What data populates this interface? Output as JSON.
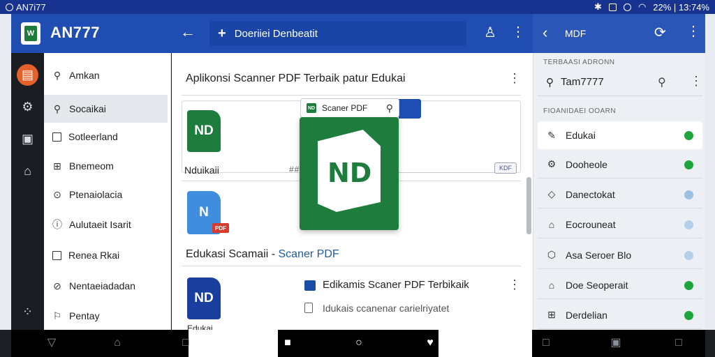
{
  "status_bar": {
    "left_text": "AN7i77",
    "right_text": "22% | 13:74%"
  },
  "header": {
    "app_title": "AN777",
    "search_text": "Doeriiei Denbeatit",
    "right_title": "MDF"
  },
  "rail": {
    "items": [
      "documents-icon",
      "settings-icon",
      "save-icon",
      "home-icon",
      "apps-icon"
    ]
  },
  "drawer": {
    "items": [
      {
        "label": "Amkan",
        "icon": "search-icon"
      },
      {
        "label": "Socaikai",
        "icon": "search-icon",
        "selected": true
      },
      {
        "label": "Sotleerland",
        "icon": "checkbox-icon"
      },
      {
        "label": "Bnemeom",
        "icon": "grid-icon"
      },
      {
        "label": "Ptenaiolacia",
        "icon": "circle-icon"
      },
      {
        "label": "Aulutaeit Isarit",
        "icon": "info-icon"
      },
      {
        "label": "Reneа Rkai",
        "icon": "checkbox-icon"
      },
      {
        "label": "Nentaeiadadan",
        "icon": "help-icon"
      },
      {
        "label": "Pentay",
        "icon": "pin-icon"
      }
    ]
  },
  "main": {
    "title": "Aplikonsi Scanner PDF Terbaik patur Edukai",
    "card1_icon_text": "ND",
    "card1_label": "Nduikaii",
    "card1_hash": "##",
    "card1_chip": "KDF",
    "card2_icon_text": "N",
    "card2_badge": "PDF",
    "section_prefix": "Edukasi Scamaii - ",
    "section_brand": "Scaner PDF",
    "card3_icon_text": "ND",
    "card3_title": "Edikamis Scaner PDF Terbikaik",
    "card3_sub": "Idukais ccanenar carielriyatet",
    "card3_caption": "Edukai"
  },
  "popup": {
    "chip_text": "Scaner PDF",
    "chip_icon_text": "ND",
    "logo_text": "ND"
  },
  "right_panel": {
    "section1": "TERBAASI ADRONN",
    "search_value": "Tam7777",
    "section2": "FIOANIDAEI OOARN",
    "items": [
      {
        "label": "Edukai",
        "icon": "edit-icon",
        "dot": "#1fa33b",
        "selected": true
      },
      {
        "label": "Dooheole",
        "icon": "settings-icon",
        "dot": "#1fa33b"
      },
      {
        "label": "Danectokat",
        "icon": "tag-icon",
        "dot": "#9dc0e0"
      },
      {
        "label": "Eocrouneat",
        "icon": "bookmark-icon",
        "dot": "#b4cfea"
      },
      {
        "label": "Asa Seroer Blo",
        "icon": "hexagon-icon",
        "dot": "#b4cfea"
      },
      {
        "label": "Doe Seoperait",
        "icon": "bookmark-icon",
        "dot": "#1fa33b"
      },
      {
        "label": "Derdelian",
        "icon": "grid-icon",
        "dot": "#1fa33b"
      }
    ]
  },
  "colors": {
    "header": "#1f4db2",
    "accent_orange": "#e2622a",
    "doc_green": "#1e7d3d"
  }
}
